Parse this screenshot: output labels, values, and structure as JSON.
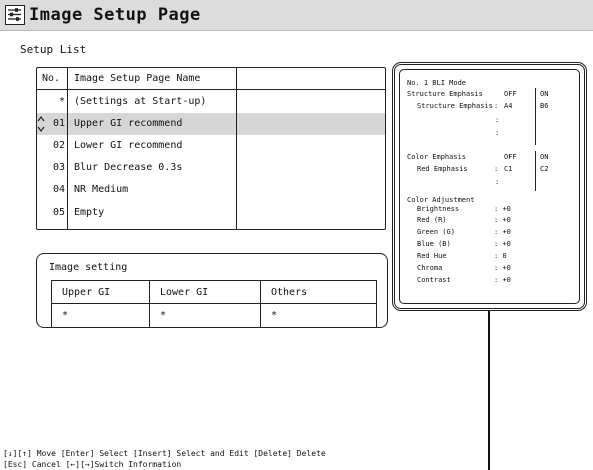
{
  "header": {
    "title": "Image Setup Page",
    "icon": "settings-sliders-icon"
  },
  "setup_list": {
    "label": "Setup List",
    "col_no": "No.",
    "col_name": "Image Setup Page Name",
    "rows": [
      {
        "no": "*",
        "name": "(Settings at Start-up)"
      },
      {
        "no": "01",
        "name": "Upper GI recommend",
        "selected": true
      },
      {
        "no": "02",
        "name": "Lower GI recommend"
      },
      {
        "no": "03",
        "name": "Blur Decrease 0.3s"
      },
      {
        "no": "04",
        "name": "NR Medium"
      },
      {
        "no": "05",
        "name": "Empty"
      }
    ]
  },
  "image_setting": {
    "label": "Image setting",
    "columns": [
      {
        "header": "Upper GI",
        "value": "*"
      },
      {
        "header": "Lower GI",
        "value": "*"
      },
      {
        "header": "Others",
        "value": "*"
      }
    ]
  },
  "info_panel": {
    "mode_title": "No. 1 BLI Mode",
    "structure": {
      "label": "Structure Emphasis",
      "off": "OFF",
      "on": "ON",
      "sub_label": "Structure Emphasis",
      "off_value": "A4",
      "on_value": "B6"
    },
    "color": {
      "label": "Color Emphasis",
      "off": "OFF",
      "on": "ON",
      "sub_label": "Red Emphasis",
      "off_value": "C1",
      "on_value": "C2"
    },
    "adjustment": {
      "label": "Color Adjustment",
      "items": [
        {
          "name": "Brightness",
          "value": "+0"
        },
        {
          "name": "Red (R)",
          "value": "+0"
        },
        {
          "name": "Green (G)",
          "value": "+0"
        },
        {
          "name": "Blue (B)",
          "value": "+0"
        },
        {
          "name": "Red Hue",
          "value": "0"
        },
        {
          "name": "Chroma",
          "value": "+0"
        },
        {
          "name": "Contrast",
          "value": "+0"
        }
      ]
    }
  },
  "help": {
    "line1": "[↓][↑] Move  [Enter] Select  [Insert] Select and Edit  [Delete] Delete",
    "line2": "[Esc] Cancel  [←][→]Switch Information"
  }
}
